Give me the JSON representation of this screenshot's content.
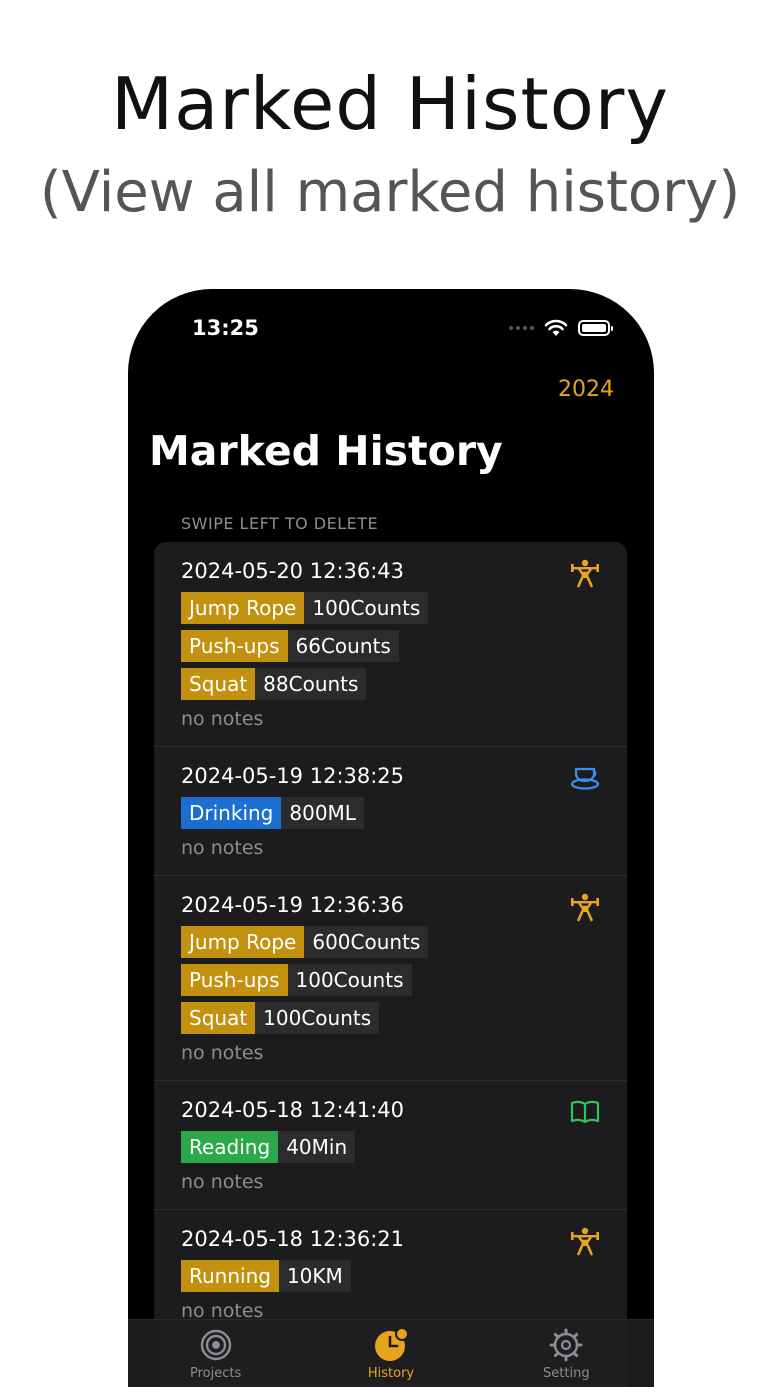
{
  "promo": {
    "title": "Marked History",
    "subtitle": "(View all marked history)"
  },
  "status_bar": {
    "time": "13:25",
    "icons": [
      "signal-icon",
      "wifi-icon",
      "battery-icon"
    ]
  },
  "nav": {
    "year_button": "2024",
    "title": "Marked History",
    "accent_color": "#e6a51d"
  },
  "list": {
    "section_header": "SWIPE LEFT TO DELETE",
    "records": [
      {
        "date": "2024-05-20 12:36:43",
        "icon": "weightlifter-icon",
        "icon_color": "#e6a51d",
        "tags": [
          {
            "name": "Jump Rope",
            "value": "100Counts",
            "color": "#c2910f"
          },
          {
            "name": "Push-ups",
            "value": "66Counts",
            "color": "#c2910f"
          },
          {
            "name": "Squat",
            "value": "88Counts",
            "color": "#c2910f"
          }
        ],
        "notes": "no notes"
      },
      {
        "date": "2024-05-19 12:38:25",
        "icon": "cup-icon",
        "icon_color": "#3b8ef0",
        "tags": [
          {
            "name": "Drinking",
            "value": "800ML",
            "color": "#1a6fd1"
          }
        ],
        "notes": "no notes"
      },
      {
        "date": "2024-05-19 12:36:36",
        "icon": "weightlifter-icon",
        "icon_color": "#e6a51d",
        "tags": [
          {
            "name": "Jump Rope",
            "value": "600Counts",
            "color": "#c2910f"
          },
          {
            "name": "Push-ups",
            "value": "100Counts",
            "color": "#c2910f"
          },
          {
            "name": "Squat",
            "value": "100Counts",
            "color": "#c2910f"
          }
        ],
        "notes": "no notes"
      },
      {
        "date": "2024-05-18 12:41:40",
        "icon": "book-icon",
        "icon_color": "#33c25a",
        "tags": [
          {
            "name": "Reading",
            "value": "40Min",
            "color": "#2aa84a"
          }
        ],
        "notes": "no notes"
      },
      {
        "date": "2024-05-18 12:36:21",
        "icon": "weightlifter-icon",
        "icon_color": "#e6a51d",
        "tags": [
          {
            "name": "Running",
            "value": "10KM",
            "color": "#c2910f"
          }
        ],
        "notes": "no notes"
      }
    ]
  },
  "tab_bar": {
    "tabs": [
      {
        "label": "Projects",
        "icon": "target-icon",
        "active": false
      },
      {
        "label": "History",
        "icon": "clock-icon",
        "active": true
      },
      {
        "label": "Setting",
        "icon": "gear-icon",
        "active": false
      }
    ],
    "active_color": "#e6a51d",
    "inactive_color": "#8d8d92"
  }
}
